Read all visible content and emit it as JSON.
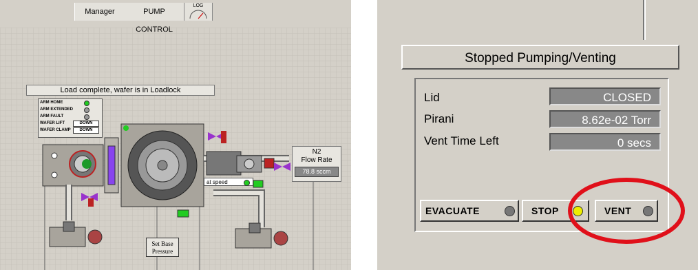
{
  "tabs": {
    "manager": "Manager",
    "pump_control": "PUMP CONTROL",
    "log": "LOG"
  },
  "left": {
    "status_message": "Load complete, wafer is in Loadlock",
    "indicators": [
      {
        "label": "ARM HOME",
        "state": "green"
      },
      {
        "label": "ARM EXTENDED",
        "state": "gray"
      },
      {
        "label": "ARM FAULT",
        "state": "gray"
      },
      {
        "label": "WAFER LIFT",
        "value": "DOWN"
      },
      {
        "label": "WAFER CLAMP",
        "value": "DOWN"
      }
    ],
    "flow": {
      "gas": "N2",
      "label": "Flow Rate",
      "value": "78.8 sccm"
    },
    "turbo_status": "at speed",
    "set_base_line1": "Set Base",
    "set_base_line2": "Pressure"
  },
  "right": {
    "title": "Stopped Pumping/Venting",
    "lid_label": "Lid",
    "lid_value": "CLOSED",
    "pirani_label": "Pirani",
    "pirani_value": "8.62e-02 Torr",
    "vent_label": "Vent Time Left",
    "vent_value": "0 secs",
    "buttons": {
      "evacuate": "EVACUATE",
      "stop": "STOP",
      "vent": "VENT"
    }
  },
  "colors": {
    "panel": "#d4d0c8",
    "led_green": "#22cc22",
    "led_yellow": "#eeee00",
    "highlight": "#e0101a"
  }
}
